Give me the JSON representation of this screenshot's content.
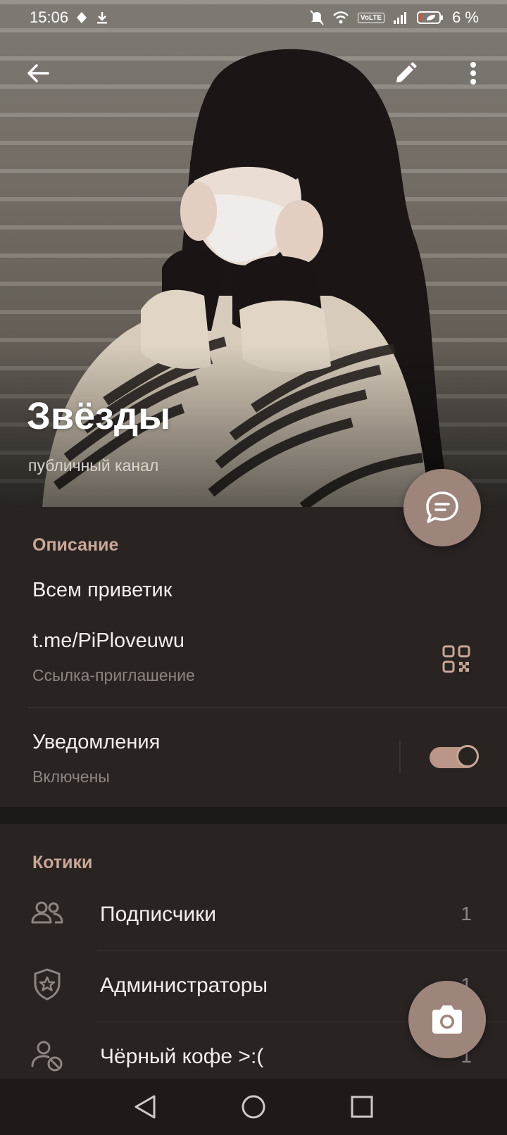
{
  "status_bar": {
    "time": "15:06",
    "battery": "6 %",
    "network_badge": "VoLTE"
  },
  "channel": {
    "name": "Звёзды",
    "type_label": "публичный канал"
  },
  "info": {
    "section_title": "Описание",
    "description": "Всем приветик",
    "link": "t.me/PiPloveuwu",
    "link_caption": "Ссылка-приглашение",
    "notifications_label": "Уведомления",
    "notifications_state": "Включены",
    "notifications_on": true
  },
  "members": {
    "section_title": "Котики",
    "rows": [
      {
        "label": "Подписчики",
        "count": "1",
        "icon": "users-icon"
      },
      {
        "label": "Администраторы",
        "count": "1",
        "icon": "shield-star-icon"
      },
      {
        "label": "Чёрный кофе >:(",
        "count": "1",
        "icon": "user-blocked-icon"
      }
    ]
  },
  "colors": {
    "accent": "#c9a797",
    "fab": "#9e857b",
    "background": "#292322"
  }
}
